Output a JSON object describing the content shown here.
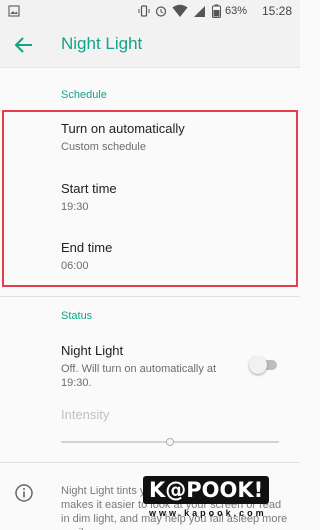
{
  "status_bar": {
    "battery_percent": "63%",
    "time": "15:28",
    "icons": [
      "image-icon",
      "vibrate-icon",
      "alarm-icon",
      "wifi-icon",
      "signal-icon",
      "battery-icon"
    ]
  },
  "app_bar": {
    "title": "Night Light",
    "back_icon": "arrow-left-icon"
  },
  "schedule": {
    "header": "Schedule",
    "turn_on_title": "Turn on automatically",
    "turn_on_summary": "Custom schedule",
    "start_title": "Start time",
    "start_value": "19:30",
    "end_title": "End time",
    "end_value": "06:00"
  },
  "status": {
    "header": "Status",
    "night_light_title": "Night Light",
    "night_light_summary": "Off. Will turn on automatically at 19:30.",
    "toggle_on": false,
    "intensity_label": "Intensity",
    "intensity_level": 0.5
  },
  "footer": {
    "text": "Night Light tints your screen amber. This makes it easier to look at your screen or read in dim light, and may help you fall asleep more easily."
  },
  "watermark": {
    "logo": "K@POOK!",
    "url": "www.kapook.com"
  },
  "colors": {
    "accent": "#13a38a",
    "highlight": "#e53d4b"
  }
}
